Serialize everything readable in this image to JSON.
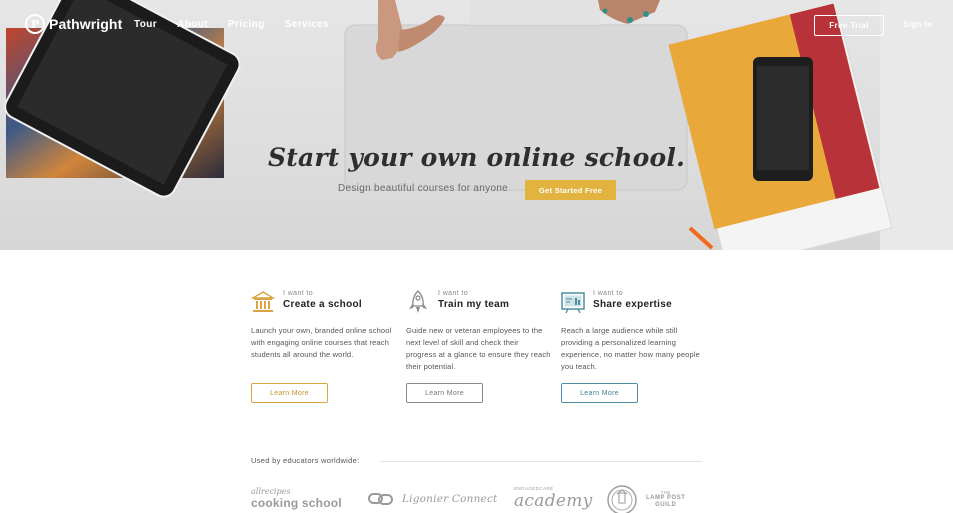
{
  "nav": {
    "logo_mark": "P",
    "logo_text": "Pathwright",
    "links": [
      "Tour",
      "About",
      "Pricing",
      "Services"
    ],
    "free_trial": "Free Trial",
    "sign_in": "Sign In"
  },
  "hero": {
    "title": "Start your own online school.",
    "subtitle": "Design beautiful courses for anyone",
    "cta": "Get Started Free"
  },
  "features": [
    {
      "kicker": "I want to",
      "title": "Create a school",
      "description": "Launch your own, branded online school with engaging online courses that reach students all around the world.",
      "button": "Learn More",
      "icon": "school-building-icon",
      "color": "#d9a441"
    },
    {
      "kicker": "I want to",
      "title": "Train my team",
      "description": "Guide new or veteran employees to the next level of skill and check their progress at a glance to ensure they reach their potential.",
      "button": "Learn More",
      "icon": "rocket-icon",
      "color": "#8a8a8a"
    },
    {
      "kicker": "I want to",
      "title": "Share expertise",
      "description": "Reach a large audience while still providing a personalized learning experience, no matter how many people you teach.",
      "button": "Learn More",
      "icon": "chalkboard-icon",
      "color": "#4f8ea1"
    }
  ],
  "educators": {
    "label": "Used by educators worldwide:",
    "allrecipes_small": "allrecipes",
    "allrecipes_big": "cooking school",
    "ligonier": "Ligonier Connect",
    "academy_small": "ENGAGEDCARE",
    "academy_big": "academy",
    "lamp_line1": "THE",
    "lamp_line2": "LAMP POST",
    "lamp_line3": "GUILD"
  }
}
